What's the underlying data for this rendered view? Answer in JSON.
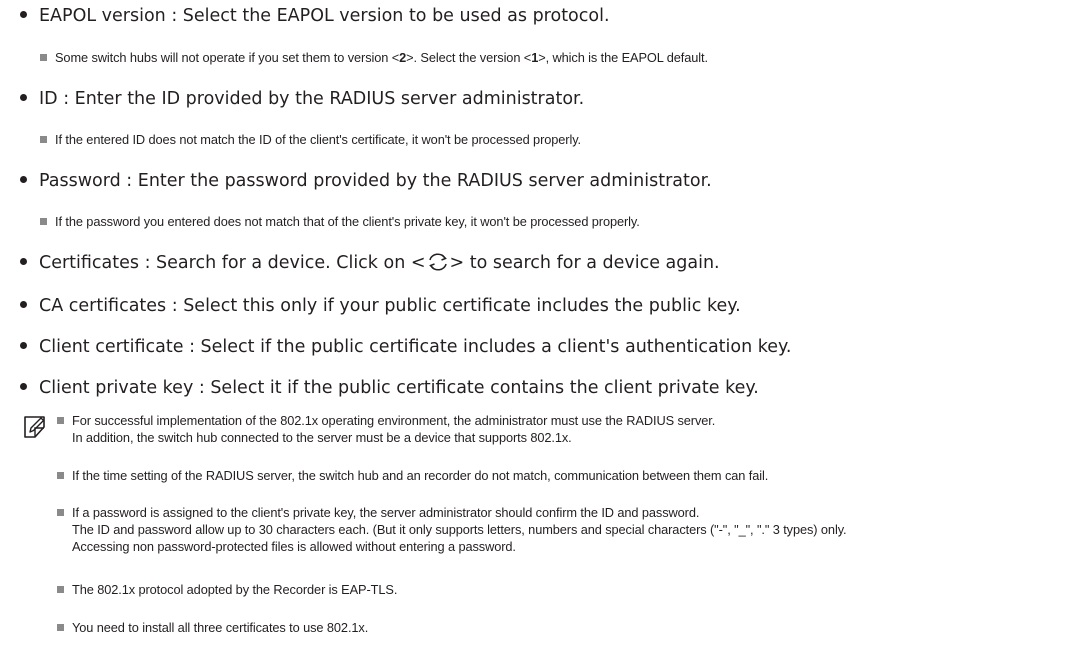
{
  "bullets": [
    {
      "text": "EAPOL version : Select the EAPOL version to be used as protocol."
    },
    {
      "text": "ID : Enter the ID provided by the RADIUS server administrator."
    },
    {
      "text": "Password : Enter the password provided by the RADIUS server administrator."
    },
    {
      "text_before": "Certificates : Search for a device. Click on <",
      "text_after": "> to search for a device again.",
      "icon": "refresh-icon"
    },
    {
      "text": "CA certificates : Select this only if your public certificate includes the public key."
    },
    {
      "text": "Client certificate : Select if the public certificate includes a client's authentication key."
    },
    {
      "text": "Client private key : Select it if the public certificate contains the client private key."
    }
  ],
  "subnotes": {
    "eapol": {
      "p1": "Some switch hubs will not operate if you set them to version <",
      "v1": "2",
      "p2": ">. Select the version <",
      "v2": "1",
      "p3": ">, which is the EAPOL default."
    },
    "id": "If the entered ID does not match the ID of the client's certificate, it won't be processed properly.",
    "password": "If the password you entered does not match that of the client's private key, it won't be processed properly."
  },
  "notes": [
    {
      "l1": "For successful implementation of the 802.1x operating environment, the administrator must use the RADIUS server.",
      "l2": "In addition, the switch hub connected to the server must be a device that supports 802.1x."
    },
    {
      "l1": "If the time setting of the RADIUS server, the switch hub and an recorder do not match, communication between them can fail."
    },
    {
      "l1": "If a password is assigned to the client's private key, the server administrator should confirm the ID and password.",
      "l2": "The ID and password allow up to 30 characters each. (But it only supports letters, numbers and special characters (\"-\", \"_\", \".\" 3 types) only.",
      "l3": "Accessing non password-protected files is allowed without entering a password."
    },
    {
      "l1": "The 802.1x protocol adopted by the Recorder is EAP-TLS."
    },
    {
      "l1": "You need to install all three certificates to use 802.1x."
    }
  ],
  "icons": {
    "note": "note-pencil-icon",
    "refresh": "refresh-icon"
  }
}
